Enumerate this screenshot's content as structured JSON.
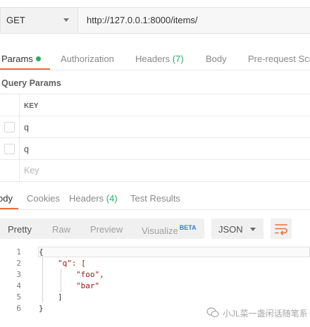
{
  "request": {
    "method": "GET",
    "url": "http://127.0.0.1:8000/items/"
  },
  "request_tabs": [
    {
      "label": "Params",
      "active": true
    },
    {
      "label": "Authorization"
    },
    {
      "label": "Headers",
      "count": "(7)"
    },
    {
      "label": "Body"
    },
    {
      "label": "Pre-request Scri"
    }
  ],
  "query_params": {
    "title": "Query Params",
    "column_key": "KEY",
    "rows": [
      "q",
      "q"
    ],
    "placeholder": "Key"
  },
  "response_tabs": [
    {
      "label": "ody",
      "active": true
    },
    {
      "label": "Cookies"
    },
    {
      "label": "Headers",
      "count": "(4)"
    },
    {
      "label": "Test Results"
    }
  ],
  "body_toolbar": {
    "views": [
      "Pretty",
      "Raw",
      "Preview",
      "Visualize"
    ],
    "beta": "BETA",
    "format": "JSON"
  },
  "code": {
    "line_numbers": [
      "1",
      "2",
      "3",
      "4",
      "5",
      "6"
    ],
    "lines": [
      "{",
      "\"q\": [",
      "\"foo\",",
      "\"bar\"",
      "]",
      "}"
    ]
  },
  "watermark": "小JL菜一盏闲话随笔系",
  "colors": {
    "accent": "#f26b3a",
    "green": "#27ae60",
    "beta": "#3c7dd9",
    "string": "#a31515"
  }
}
